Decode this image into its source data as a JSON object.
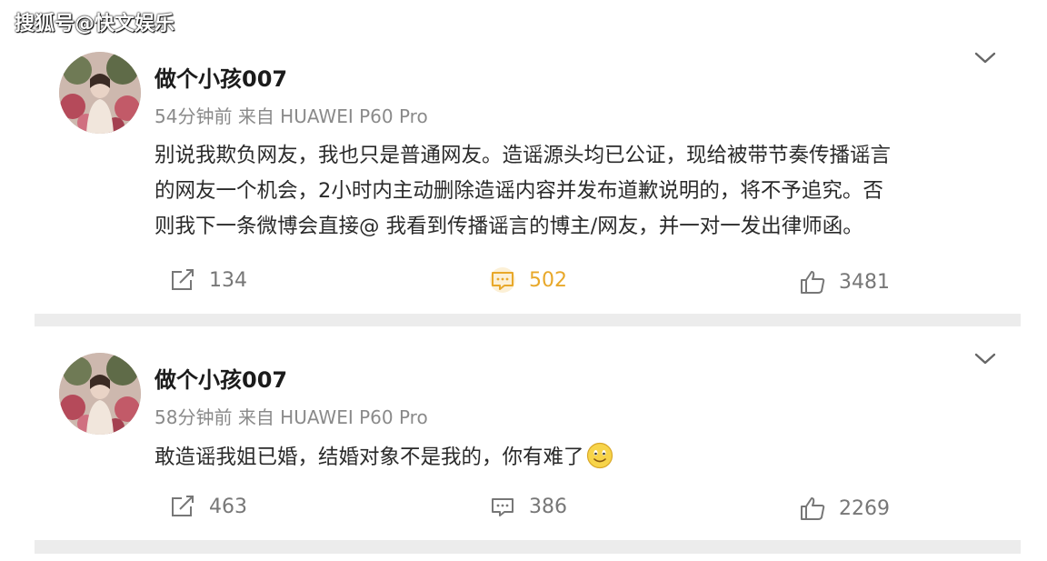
{
  "watermark": "搜狐号@快文娱乐",
  "posts": [
    {
      "username": "做个小孩007",
      "time": "54分钟前",
      "source": "来自 HUAWEI P60 Pro",
      "content_lines": [
        "别说我欺负网友，我也只是普通网友。造谣源头均已公证，现给被带节奏传播谣言",
        "的网友一个机会，2小时内主动删除造谣内容并发布道歉说明的，将不予追究。否",
        "则我下一条微博会直接@ 我看到传播谣言的博主/网友，并一对一发出律师函。"
      ],
      "reposts": "134",
      "comments": "502",
      "likes": "3481",
      "comments_active": true
    },
    {
      "username": "做个小孩007",
      "time": "58分钟前",
      "source": "来自 HUAWEI P60 Pro",
      "content_lines": [
        "敢造谣我姐已婚，结婚对象不是我的，你有难了"
      ],
      "reposts": "463",
      "comments": "386",
      "likes": "2269",
      "comments_active": false
    }
  ],
  "icons": {
    "repost": "repost-icon",
    "comment": "comment-icon",
    "like": "thumbs-up-icon",
    "menu": "chevron-down-icon",
    "emoji": "smile-emoji-icon"
  },
  "colors": {
    "accent": "#e8a82a",
    "meta": "#8a8a8a",
    "divider": "#ececec"
  }
}
